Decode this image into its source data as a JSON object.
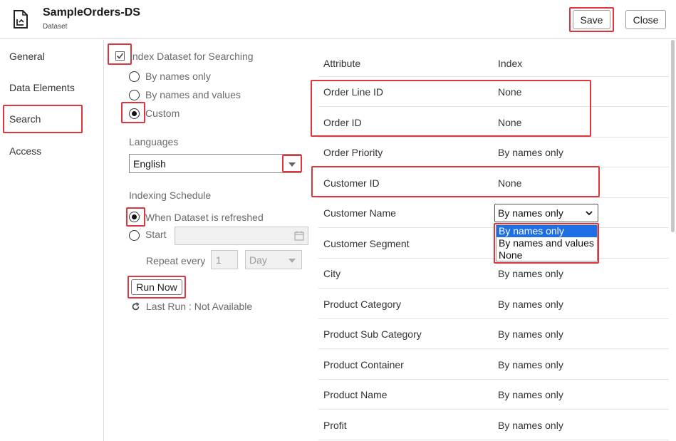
{
  "header": {
    "title": "SampleOrders-DS",
    "subtitle": "Dataset",
    "save_label": "Save",
    "close_label": "Close"
  },
  "nav": {
    "items": [
      "General",
      "Data Elements",
      "Search",
      "Access"
    ],
    "selected": "Search"
  },
  "search": {
    "index_label": "Index Dataset for Searching",
    "index_checked": true,
    "options": [
      "By names only",
      "By names and values",
      "Custom"
    ],
    "selected_option": "Custom",
    "languages_label": "Languages",
    "language_value": "English",
    "schedule_label": "Indexing Schedule",
    "schedule_refreshed": "When Dataset is refreshed",
    "schedule_start": "Start",
    "repeat_label": "Repeat every",
    "repeat_value": "1",
    "repeat_unit": "Day",
    "run_now_label": "Run Now",
    "last_run": "Last Run : Not Available"
  },
  "table": {
    "headers": [
      "Attribute",
      "Index"
    ],
    "rows": [
      {
        "attribute": "Order Line ID",
        "index": "None"
      },
      {
        "attribute": "Order ID",
        "index": "None"
      },
      {
        "attribute": "Order Priority",
        "index": "By names only"
      },
      {
        "attribute": "Customer ID",
        "index": "None"
      },
      {
        "attribute": "Customer Name",
        "index": "By names only"
      },
      {
        "attribute": "Customer Segment",
        "index": ""
      },
      {
        "attribute": "City",
        "index": "By names only"
      },
      {
        "attribute": "Product Category",
        "index": "By names only"
      },
      {
        "attribute": "Product Sub Category",
        "index": "By names only"
      },
      {
        "attribute": "Product Container",
        "index": "By names only"
      },
      {
        "attribute": "Product Name",
        "index": "By names only"
      },
      {
        "attribute": "Profit",
        "index": "By names only"
      }
    ],
    "dropdown_options": [
      "By names only",
      "By names and values",
      "None"
    ],
    "dropdown_selected": "By names only"
  },
  "colors": {
    "highlight": "#e0353d",
    "selection": "#1e6ee6"
  }
}
